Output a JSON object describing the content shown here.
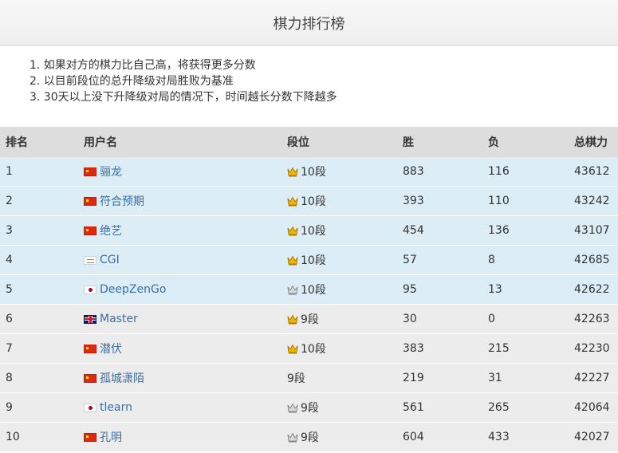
{
  "header": {
    "title": "棋力排行榜"
  },
  "notes": [
    "1. 如果对方的棋力比自己高，将获得更多分数",
    "2. 以目前段位的总升降级对局胜败为基准",
    "3. 30天以上没下升降级对局的情况下，时间越长分数下降越多"
  ],
  "table": {
    "headers": {
      "rank": "排名",
      "user": "用户名",
      "level": "段位",
      "wins": "胜",
      "losses": "负",
      "score": "总棋力"
    },
    "rows": [
      {
        "rank": "1",
        "flag": "cn",
        "user": "骊龙",
        "crown": "gold",
        "level": "10段",
        "wins": "883",
        "losses": "116",
        "score": "43612",
        "highlight": true
      },
      {
        "rank": "2",
        "flag": "cn",
        "user": "符合预期",
        "crown": "gold",
        "level": "10段",
        "wins": "393",
        "losses": "110",
        "score": "43242",
        "highlight": true
      },
      {
        "rank": "3",
        "flag": "cn",
        "user": "绝艺",
        "crown": "gold",
        "level": "10段",
        "wins": "454",
        "losses": "136",
        "score": "43107",
        "highlight": true
      },
      {
        "rank": "4",
        "flag": "olympic",
        "user": "CGI",
        "crown": "gold",
        "level": "10段",
        "wins": "57",
        "losses": "8",
        "score": "42685",
        "highlight": true
      },
      {
        "rank": "5",
        "flag": "jp",
        "user": "DeepZenGo",
        "crown": "gray",
        "level": "10段",
        "wins": "95",
        "losses": "13",
        "score": "42622",
        "highlight": true
      },
      {
        "rank": "6",
        "flag": "uk",
        "user": "Master",
        "crown": "gold",
        "level": "9段",
        "wins": "30",
        "losses": "0",
        "score": "42263",
        "highlight": false
      },
      {
        "rank": "7",
        "flag": "cn",
        "user": "潜伏",
        "crown": "gold",
        "level": "10段",
        "wins": "383",
        "losses": "215",
        "score": "42230",
        "highlight": false
      },
      {
        "rank": "8",
        "flag": "cn",
        "user": "孤城潇陌",
        "crown": "none",
        "level": "9段",
        "wins": "219",
        "losses": "31",
        "score": "42227",
        "highlight": false
      },
      {
        "rank": "9",
        "flag": "jp",
        "user": "tlearn",
        "crown": "gray",
        "level": "9段",
        "wins": "561",
        "losses": "265",
        "score": "42064",
        "highlight": false
      },
      {
        "rank": "10",
        "flag": "cn",
        "user": "孔明",
        "crown": "gray",
        "level": "9段",
        "wins": "604",
        "losses": "433",
        "score": "42027",
        "highlight": false
      }
    ]
  },
  "colors": {
    "crown_gold": "#f2b600",
    "crown_gold_stroke": "#b07d00",
    "crown_gray": "#d9d9d9",
    "crown_gray_stroke": "#888888",
    "link": "#3a6ea5",
    "highlight_row": "#dcedf6",
    "normal_row": "#ececec",
    "header_row": "#dddddd"
  }
}
